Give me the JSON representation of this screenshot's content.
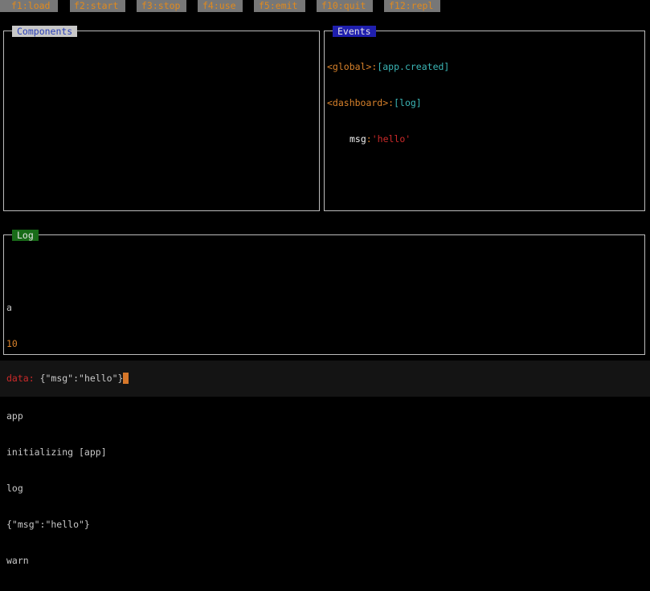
{
  "keybar": {
    "keys": [
      {
        "label": "f1:load"
      },
      {
        "label": "f2:start"
      },
      {
        "label": "f3:stop"
      },
      {
        "label": "f4:use"
      },
      {
        "label": "f5:emit"
      },
      {
        "label": "f10:quit"
      },
      {
        "label": "f12:repl"
      }
    ]
  },
  "components": {
    "title": "Components"
  },
  "events": {
    "title": "Events",
    "lines": [
      {
        "scope": "<global>",
        "sep": ":",
        "event": "[app.created]"
      },
      {
        "scope": "<dashboard>",
        "sep": ":",
        "event": "[log]"
      }
    ],
    "detail": {
      "key": "msg",
      "sep": ":",
      "value": "'hello'"
    }
  },
  "log": {
    "title": "Log",
    "lines": [
      {
        "text": "",
        "color": "grey"
      },
      {
        "text": "a",
        "color": "grey"
      },
      {
        "text": "10",
        "color": "orange"
      },
      {
        "text": "",
        "color": "grey"
      },
      {
        "text": "app",
        "color": "grey"
      },
      {
        "text": "initializing [app]",
        "color": "grey"
      },
      {
        "text": "log",
        "color": "grey"
      },
      {
        "text": "{\"msg\":\"hello\"}",
        "color": "grey"
      },
      {
        "text": "warn",
        "color": "grey"
      }
    ]
  },
  "input": {
    "prompt": "data:",
    "value": "{\"msg\":\"hello\"}"
  },
  "colors": {
    "accent": "#d9822b",
    "keybar_bg": "#777777",
    "events_title_bg": "#1f1fae",
    "log_title_bg": "#186b18",
    "components_title_bg": "#c8c8c8",
    "cyan": "#3bb6b6",
    "red": "#cc2a2a"
  }
}
